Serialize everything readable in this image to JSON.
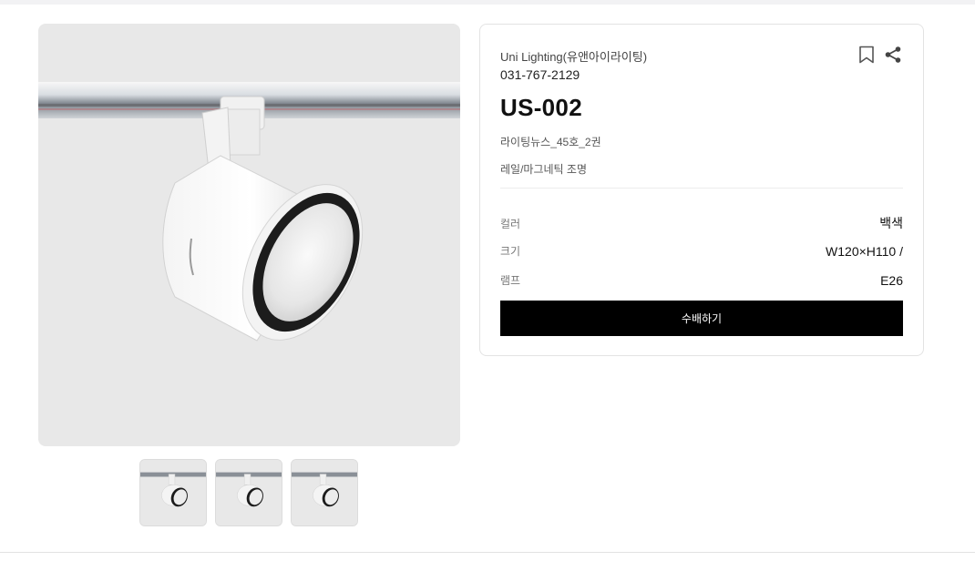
{
  "product": {
    "brand": "Uni Lighting(유앤아이라이팅)",
    "phone": "031-767-2129",
    "model": "US-002",
    "issue": "라이팅뉴스_45호_2권",
    "category": "레일/마그네틱 조명"
  },
  "specs": [
    {
      "label": "컬러",
      "value": "백색"
    },
    {
      "label": "크기",
      "value": "W120×H110 /"
    },
    {
      "label": "램프",
      "value": "E26"
    }
  ],
  "actions": {
    "order_label": "수배하기",
    "bookmark_icon": "bookmark-icon",
    "share_icon": "share-icon"
  },
  "gallery": {
    "thumbnail_count": 3
  },
  "colors": {
    "button_bg": "#000000",
    "image_bg": "#e8e8e8"
  }
}
